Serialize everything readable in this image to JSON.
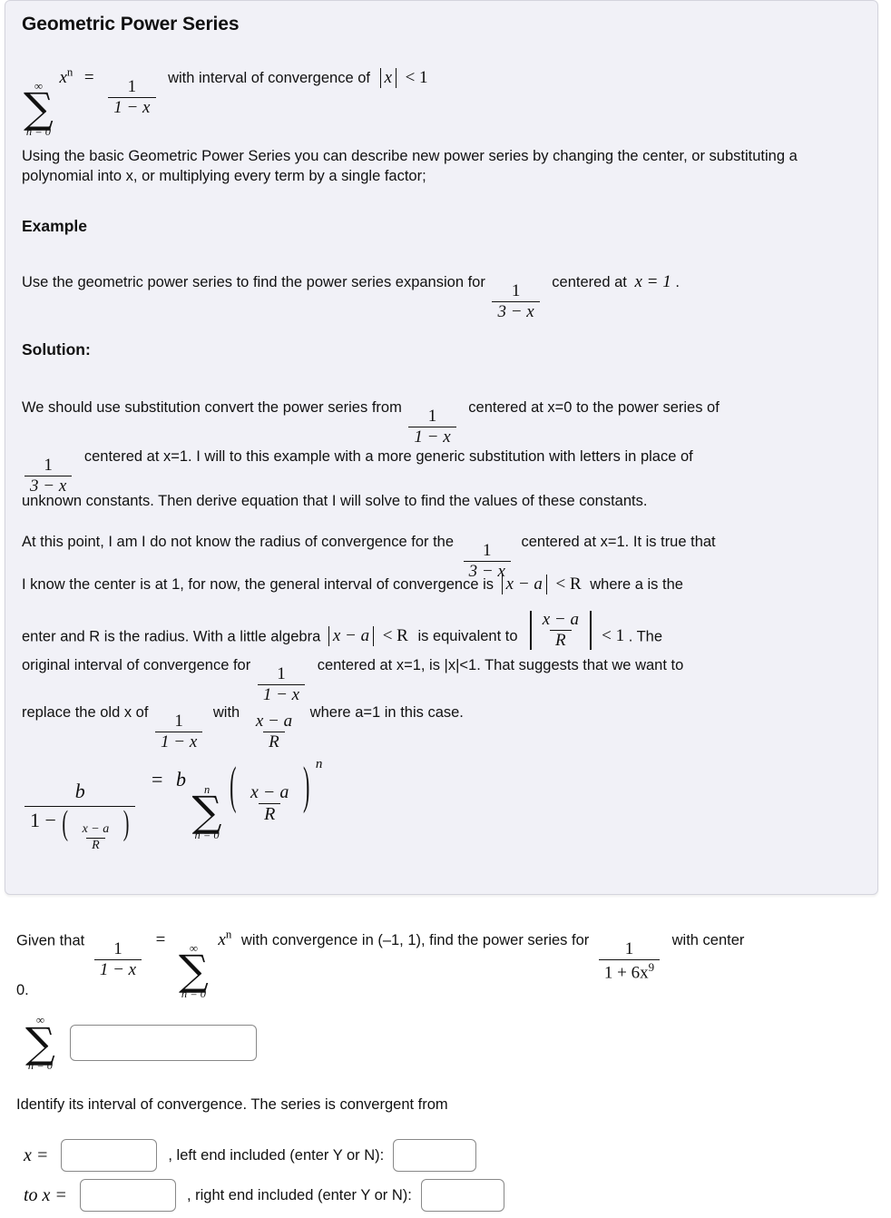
{
  "panel": {
    "title": "Geometric Power Series",
    "formula_intro": {
      "sum_upper": "∞",
      "sum_lower": "n = 0",
      "term": "x",
      "term_exp": "n",
      "equals": "=",
      "frac_num": "1",
      "frac_den": "1 − x",
      "tail": "with interval of convergence of",
      "abs_arg": "x",
      "rel": "< 1"
    },
    "paragraph_1": "Using the basic Geometric Power Series you can describe new power series by changing the center, or substituting a polynomial into x, or multiplying every term by a single factor;",
    "example_heading": "Example",
    "example_text_before": "Use the geometric power series to find the power series expansion for",
    "example_frac_num": "1",
    "example_frac_den": "3 − x",
    "example_text_after": "centered at",
    "example_center": "x = 1",
    "example_period": ".",
    "solution_heading": "Solution:",
    "solution_p1_a": "We should use substitution convert the power series from",
    "solution_p1_frac_num": "1",
    "solution_p1_frac_den": "1 − x",
    "solution_p1_b": "centered at x=0 to the power series of",
    "solution_p2_frac_num": "1",
    "solution_p2_frac_den": "3 − x",
    "solution_p2_a": "centered at x=1.  I will to this example with a more generic substitution with letters in place of",
    "solution_p3": "unknown constants.  Then derive equation that I will solve to find the values of these constants.",
    "para2_a": "At this point, I am I do not know the radius of convergence for the",
    "para2_frac_num": "1",
    "para2_frac_den": "3 − x",
    "para2_b": "centered at x=1.  It is true that",
    "para2_c": "I know the center is at 1, for now, the general interval of convergence is",
    "para2_abs1": "x − a",
    "para2_rel1": "< R",
    "para2_d": "where a is the",
    "para2_e": "enter and R is the radius.  With a little algebra",
    "para2_abs2": "x − a",
    "para2_rel2": "< R",
    "para2_f": "is equivalent to",
    "para2_bigfrac_num": "x − a",
    "para2_bigfrac_den": "R",
    "para2_rel3": "< 1",
    "para2_g": ".  The",
    "para3_a": "original interval of convergence for",
    "para3_frac_num": "1",
    "para3_frac_den": "1 − x",
    "para3_b": "centered at x=1, is |x|<1.  That suggests that we want to",
    "para4_a": "replace the old x of",
    "para4_frac1_num": "1",
    "para4_frac1_den": "1 − x",
    "para4_with": "with",
    "para4_frac2_num": "x − a",
    "para4_frac2_den": "R",
    "para4_b": "where a=1 in this case.",
    "display_eq": {
      "lhs_num": "b",
      "lhs_den_lead": "1 −",
      "lhs_den_frac_num": "x − a",
      "lhs_den_frac_den": "R",
      "equals": "=",
      "coef": "b",
      "sum_upper": "n",
      "sum_lower": "n = 0",
      "inner_num": "x − a",
      "inner_den": "R",
      "exponent": "n"
    }
  },
  "question": {
    "given_that": "Given that",
    "given_frac_num": "1",
    "given_frac_den": "1 − x",
    "equals": "=",
    "sum_upper": "∞",
    "sum_lower": "n = 0",
    "sum_term": "x",
    "sum_term_exp": "n",
    "mid_text": "with convergence in (–1, 1), find the power series for",
    "target_num": "1",
    "target_den_a": "1 + 6x",
    "target_den_exp": "9",
    "tail_text": "with center",
    "center_value": "0.",
    "answer_sum_upper": "∞",
    "answer_sum_lower": "n = 0",
    "answer_placeholder": "",
    "answer_value": "",
    "interval_prompt": "Identify its interval of convergence. The series is convergent from",
    "left_label": "x =",
    "left_value": "",
    "left_included_label": ", left end included (enter Y or N):",
    "left_included_value": "",
    "right_label": "to x =",
    "right_value": "",
    "right_included_label": ", right end included (enter Y or N):",
    "right_included_value": ""
  },
  "colors": {
    "panel_bg": "#f1f1f7",
    "panel_border": "#d4d4dd",
    "text": "#111111",
    "field_border": "#888888",
    "page_bg": "#ffffff"
  }
}
